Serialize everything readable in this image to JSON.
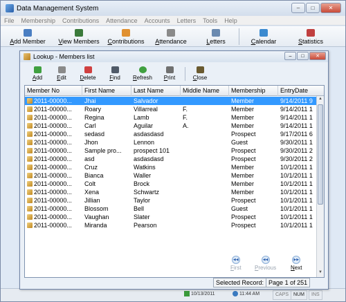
{
  "app": {
    "title": "Data Management System"
  },
  "window_controls": {
    "minimize": "–",
    "maximize": "□",
    "close": "✕"
  },
  "menu": [
    "File",
    "Membership",
    "Contributions",
    "Attendance",
    "Accounts",
    "Letters",
    "Tools",
    "Help"
  ],
  "toolbar": [
    {
      "label": "Add Member",
      "icon": "add-member-icon",
      "color": "#4a7ec2"
    },
    {
      "label": "View Members",
      "icon": "view-members-icon",
      "color": "#3b7a3b"
    },
    {
      "label": "Contributions",
      "icon": "contributions-icon",
      "color": "#e09030"
    },
    {
      "label": "Attendance",
      "icon": "attendance-icon",
      "color": "#8a8a8a"
    },
    {
      "label": "Letters",
      "icon": "letters-icon",
      "color": "#6a8ab0"
    },
    {
      "label": "Calendar",
      "icon": "calendar-icon",
      "color": "#3a8ad0"
    },
    {
      "label": "Statistics",
      "icon": "statistics-icon",
      "color": "#c04040"
    }
  ],
  "child_window": {
    "title": "Lookup - Members list",
    "toolbar": [
      {
        "label": "Add",
        "icon": "add-icon",
        "color": "#40a040"
      },
      {
        "label": "Edit",
        "icon": "edit-icon",
        "color": "#8a8a8a"
      },
      {
        "label": "Delete",
        "icon": "delete-icon",
        "color": "#d04040"
      },
      {
        "label": "Find",
        "icon": "binoculars-icon",
        "color": "#505a68"
      },
      {
        "label": "Refresh",
        "icon": "refresh-icon",
        "color": "#40a040"
      },
      {
        "label": "Print",
        "icon": "printer-icon",
        "color": "#707070"
      },
      {
        "label": "Close",
        "icon": "close-door-icon",
        "color": "#6a5a30"
      }
    ]
  },
  "table": {
    "columns": [
      "Member No",
      "First Name",
      "Last Name",
      "Middle Name",
      "Membership",
      "EntryDate"
    ],
    "rows": [
      [
        "2011-00000...",
        "Jhai",
        "Salvador",
        "",
        "Member",
        "9/14/2011 9"
      ],
      [
        "2011-00000...",
        "Roary",
        "Villarreal",
        "F.",
        "Member",
        "9/14/2011 1"
      ],
      [
        "2011-00000...",
        "Regina",
        "Lamb",
        "F.",
        "Member",
        "9/14/2011 1"
      ],
      [
        "2011-00000...",
        "Carl",
        "Aguilar",
        "A.",
        "Member",
        "9/14/2011 1"
      ],
      [
        "2011-00000...",
        "sedasd",
        "asdasdasd",
        "",
        "Prospect",
        "9/17/2011 6"
      ],
      [
        "2011-00000...",
        "Jhon",
        "Lennon",
        "",
        "Guest",
        "9/30/2011 1"
      ],
      [
        "2011-00000...",
        "Sample pro...",
        "prospect 101",
        "",
        "Prospect",
        "9/30/2011 2"
      ],
      [
        "2011-00000...",
        "asd",
        "asdasdasd",
        "",
        "Prospect",
        "9/30/2011 2"
      ],
      [
        "2011-00000...",
        "Cruz",
        "Watkins",
        "",
        "Member",
        "10/1/2011 1"
      ],
      [
        "2011-00000...",
        "Bianca",
        "Waller",
        "",
        "Member",
        "10/1/2011 1"
      ],
      [
        "2011-00000...",
        "Colt",
        "Brock",
        "",
        "Member",
        "10/1/2011 1"
      ],
      [
        "2011-00000...",
        "Xena",
        "Schwartz",
        "",
        "Member",
        "10/1/2011 1"
      ],
      [
        "2011-00000...",
        "Jillian",
        "Taylor",
        "",
        "Prospect",
        "10/1/2011 1"
      ],
      [
        "2011-00000...",
        "Blossom",
        "Bell",
        "",
        "Guest",
        "10/1/2011 1"
      ],
      [
        "2011-00000...",
        "Vaughan",
        "Slater",
        "",
        "Prospect",
        "10/1/2011 1"
      ],
      [
        "2011-00000...",
        "Miranda",
        "Pearson",
        "",
        "Prospect",
        "10/1/2011 1"
      ]
    ],
    "selected_row": 0
  },
  "navigation": {
    "first": "First",
    "previous": "Previous",
    "next": "Next"
  },
  "record_info": {
    "label": "Selected Record:",
    "page": "Page 1 of 251"
  },
  "statusbar": {
    "date": "10/13/2011",
    "time": "11:44 AM",
    "caps": "CAPS",
    "num": "NUM",
    "ins": "INS"
  },
  "colors": {
    "selection": "#3399ff",
    "window_bg": "#dfe9f5"
  }
}
